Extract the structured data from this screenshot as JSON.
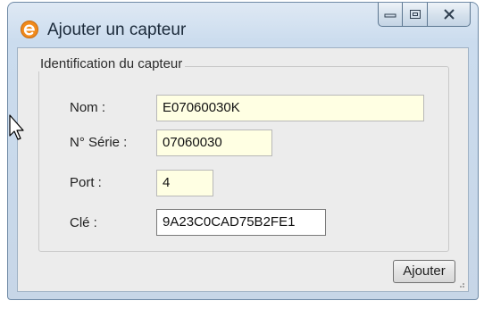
{
  "window": {
    "title": "Ajouter un capteur",
    "app_icon": "orange-circle-e-icon",
    "controls": {
      "minimize_icon": "minimize-icon",
      "maximize_icon": "maximize-icon",
      "close_icon": "close-icon"
    }
  },
  "group": {
    "legend": "Identification du capteur"
  },
  "form": {
    "nom": {
      "label": "Nom :",
      "value": "E07060030K"
    },
    "serie": {
      "label": "N° Série :",
      "value": "07060030"
    },
    "port": {
      "label": "Port :",
      "value": "4"
    },
    "cle": {
      "label": "Clé :",
      "value": "9A23C0CAD75B2FE1"
    }
  },
  "actions": {
    "ajouter_label": "Ajouter"
  },
  "colors": {
    "title_bar": "#cbdcee",
    "client_bg": "#ececec",
    "field_yellow": "#ffffe3",
    "app_icon_orange": "#f08a1c"
  }
}
